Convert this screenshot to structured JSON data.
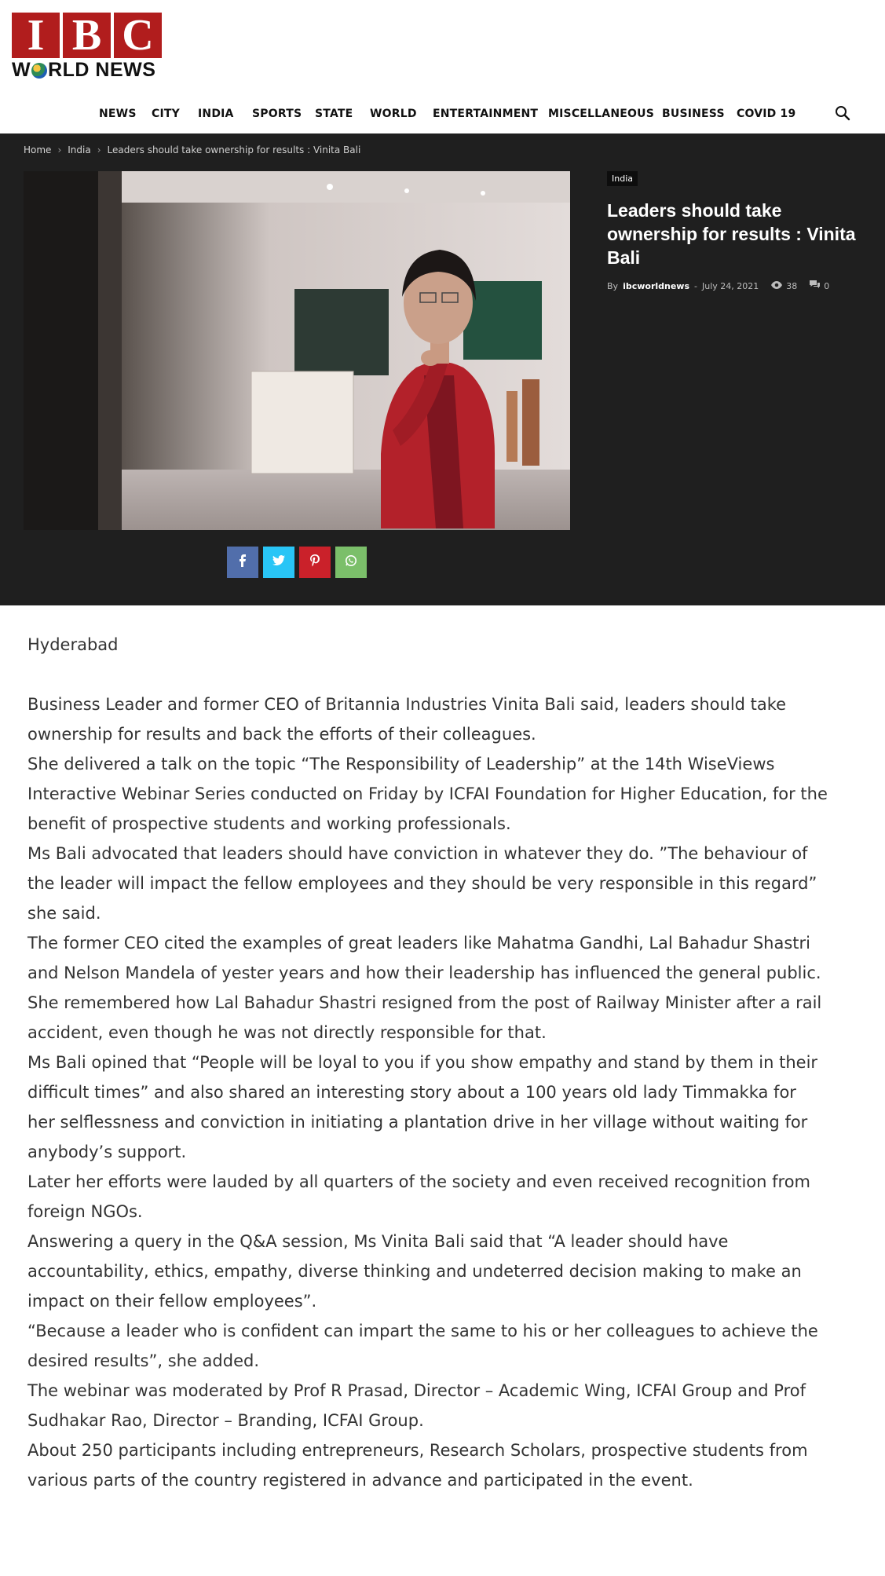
{
  "brand": {
    "logo_letters": [
      "I",
      "B",
      "C"
    ],
    "logo_sub_pre": "W",
    "logo_sub_post": "RLD NEWS"
  },
  "nav": {
    "items": [
      "NEWS",
      "CITY",
      "INDIA",
      "SPORTS",
      "STATE",
      "WORLD",
      "ENTERTAINMENT",
      "MISCELLANEOUS",
      "BUSINESS",
      "COVID 19"
    ]
  },
  "breadcrumb": {
    "home": "Home",
    "section": "India",
    "current": "Leaders should take ownership for results : Vinita Bali",
    "separator": "›"
  },
  "post": {
    "category": "India",
    "title": "Leaders should take ownership for results : Vinita Bali",
    "by": "By",
    "author": "ibcworldnews",
    "dash": "-",
    "date": "July 24, 2021",
    "views": "38",
    "comments": "0"
  },
  "share": {
    "buttons": [
      {
        "name": "facebook",
        "glyph": "f",
        "color": "#516eab"
      },
      {
        "name": "twitter",
        "glyph": "t",
        "color": "#29c5f6"
      },
      {
        "name": "pinterest",
        "glyph": "p",
        "color": "#ca212a"
      },
      {
        "name": "whatsapp",
        "glyph": "w",
        "color": "#7bbf6a"
      }
    ]
  },
  "article": {
    "location": "Hyderabad",
    "paragraphs": [
      "Business Leader and former CEO of Britannia Industries Vinita Bali said, leaders should take ownership for results and back the efforts of their colleagues.",
      "She delivered a talk on the topic “The Responsibility of Leadership” at the 14th WiseViews Interactive Webinar Series conducted on Friday by ICFAI Foundation for Higher Education, for the benefit of prospective students and working professionals.",
      "Ms Bali advocated that leaders should have conviction in whatever they do. ”The behaviour of the leader will impact the fellow employees and they should be very responsible in this regard” she said.",
      "The former CEO cited the examples of great leaders like Mahatma Gandhi, Lal Bahadur Shastri and Nelson Mandela of yester years and how their leadership has influenced the general public.",
      "She remembered how Lal Bahadur Shastri resigned from the post of Railway Minister after a rail accident, even though he was not directly responsible for that.",
      "Ms Bali opined that “People will be loyal to you if you show empathy and stand by them in their difficult times” and also shared an interesting story about a 100 years old lady Timmakka for her selflessness and conviction in initiating a plantation drive in her village without waiting for anybody’s support.",
      "Later her efforts were lauded by all quarters of the society and even received recognition from foreign NGOs.",
      "Answering a query in the Q&A session, Ms Vinita Bali said that “A leader should have accountability, ethics, empathy, diverse thinking and undeterred decision making to make an impact on their fellow employees”.",
      "“Because a leader who is confident can impart the same to his or her colleagues to achieve the desired results”, she added.",
      "The webinar was moderated by Prof R Prasad, Director – Academic Wing, ICFAI Group and Prof Sudhakar Rao, Director – Branding, ICFAI Group.",
      "About 250 participants including entrepreneurs, Research Scholars, prospective students from various parts of the country registered in advance and participated in the event."
    ]
  }
}
